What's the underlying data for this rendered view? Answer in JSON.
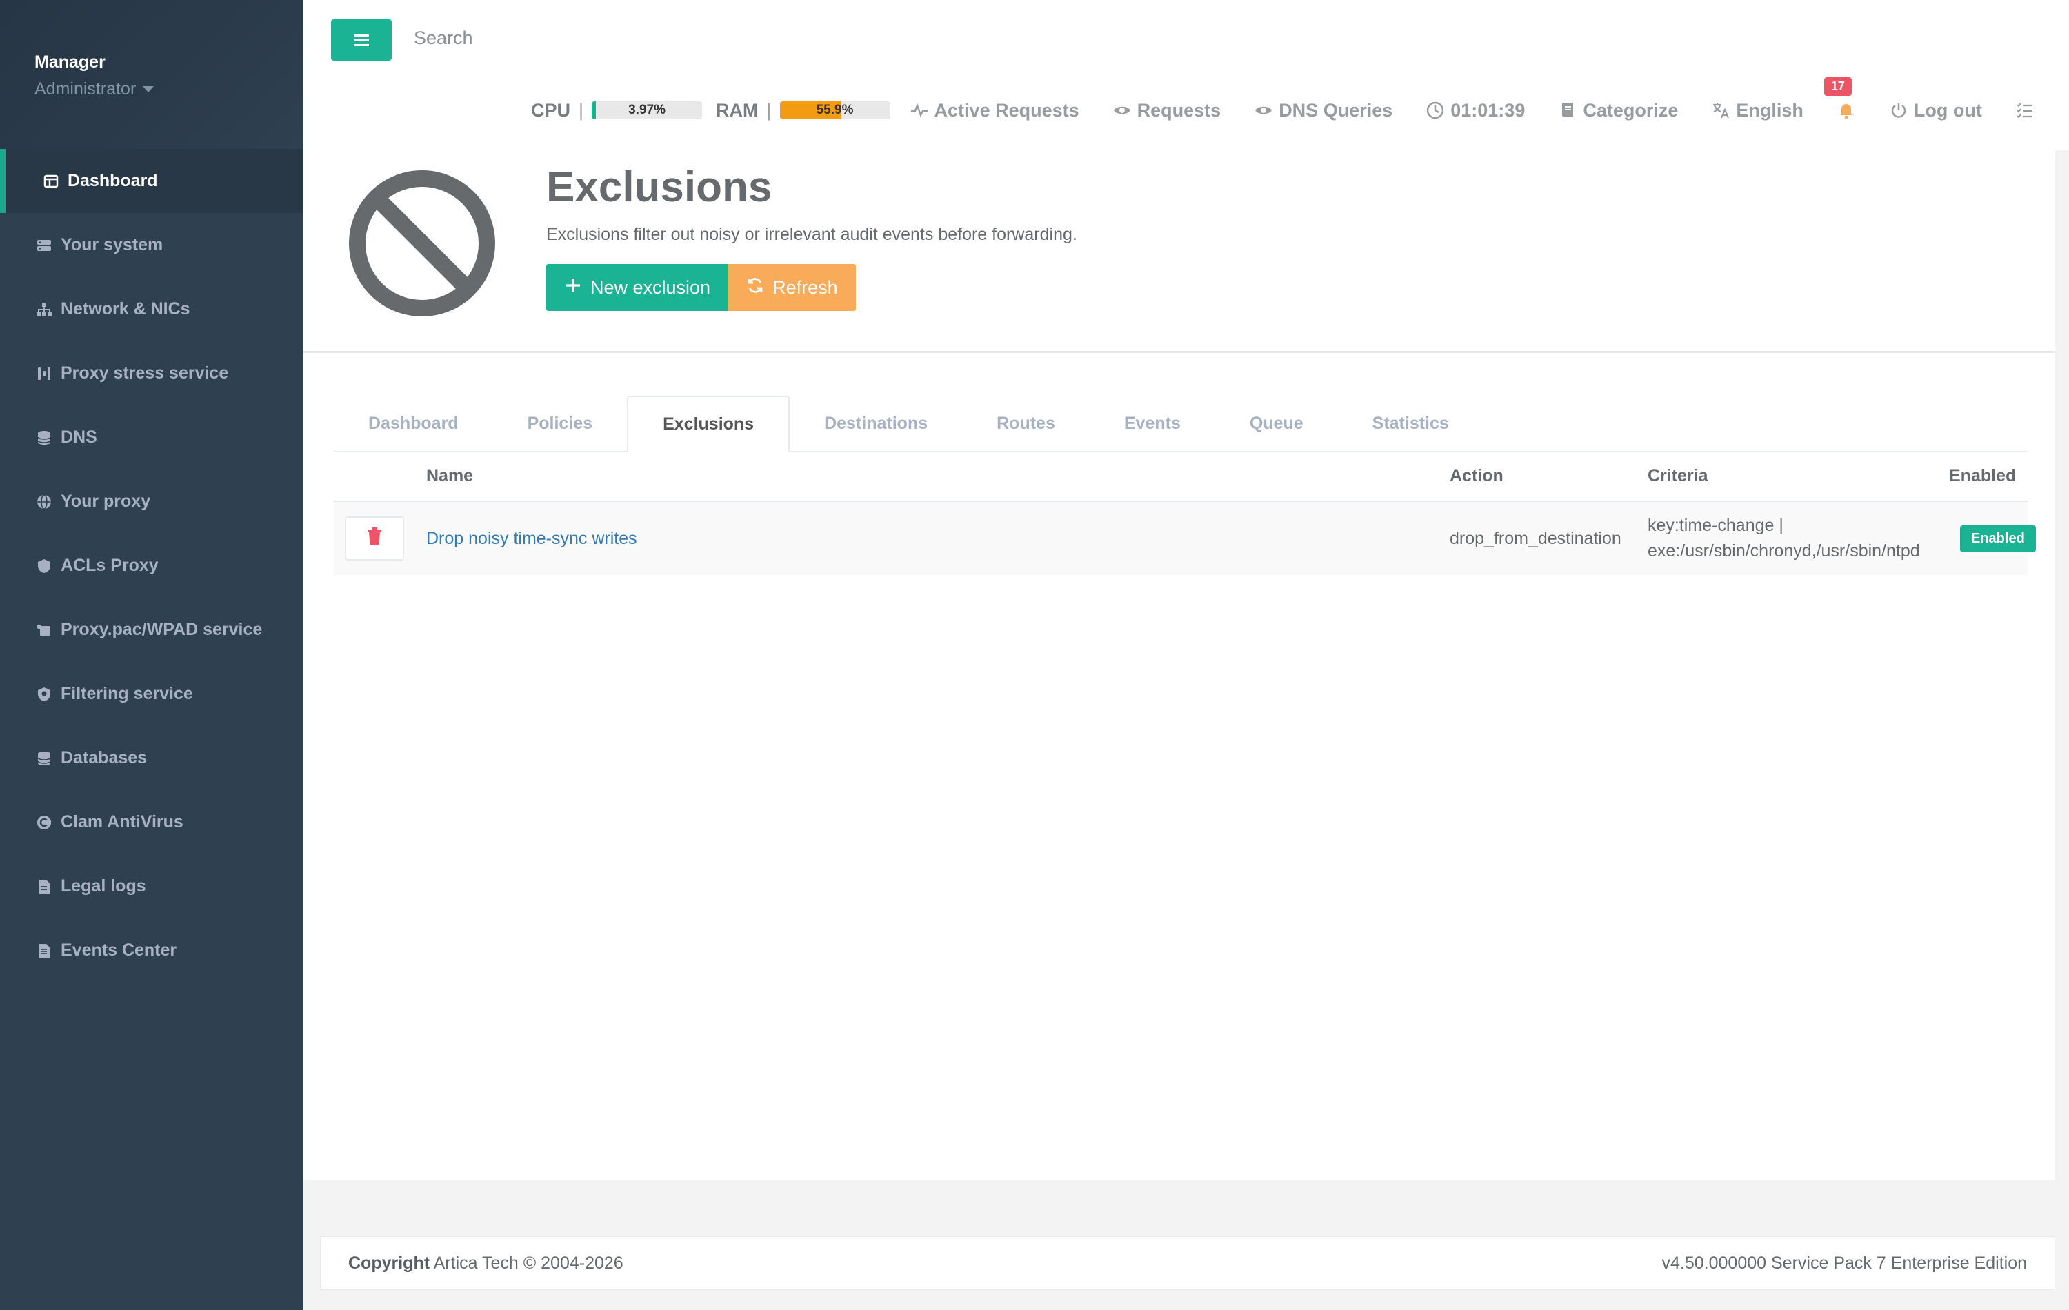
{
  "sidebar": {
    "user_name": "Manager",
    "user_role": "Administrator",
    "items": [
      {
        "label": "Dashboard",
        "icon": "dashboard-icon"
      },
      {
        "label": "Your system",
        "icon": "server-icon"
      },
      {
        "label": "Network & NICs",
        "icon": "network-icon"
      },
      {
        "label": "Proxy stress service",
        "icon": "stress-icon"
      },
      {
        "label": "DNS",
        "icon": "database-icon"
      },
      {
        "label": "Your proxy",
        "icon": "globe-icon"
      },
      {
        "label": "ACLs Proxy",
        "icon": "shield-icon"
      },
      {
        "label": "Proxy.pac/WPAD service",
        "icon": "scroll-icon"
      },
      {
        "label": "Filtering service",
        "icon": "shield-virus-icon"
      },
      {
        "label": "Databases",
        "icon": "database-icon"
      },
      {
        "label": "Clam AntiVirus",
        "icon": "clam-icon"
      },
      {
        "label": "Legal logs",
        "icon": "file-icon"
      },
      {
        "label": "Events Center",
        "icon": "file-lines-icon"
      }
    ]
  },
  "topbar": {
    "search_placeholder": "Search",
    "cpu_label": "CPU",
    "cpu_value": "3.97%",
    "cpu_fraction": 0.0397,
    "ram_label": "RAM",
    "ram_value": "55.9%",
    "ram_fraction": 0.559,
    "active_requests": "Active Requests",
    "requests": "Requests",
    "dns_queries": "DNS Queries",
    "time": "01:01:39",
    "categorize": "Categorize",
    "language": "English",
    "notifications": "17",
    "logout": "Log out"
  },
  "header": {
    "title": "Exclusions",
    "subtitle": "Exclusions filter out noisy or irrelevant audit events before forwarding.",
    "new_button": "New exclusion",
    "refresh_button": "Refresh"
  },
  "tabs": [
    {
      "label": "Dashboard"
    },
    {
      "label": "Policies"
    },
    {
      "label": "Exclusions"
    },
    {
      "label": "Destinations"
    },
    {
      "label": "Routes"
    },
    {
      "label": "Events"
    },
    {
      "label": "Queue"
    },
    {
      "label": "Statistics"
    }
  ],
  "table": {
    "headers": {
      "name": "Name",
      "action": "Action",
      "criteria": "Criteria",
      "enabled": "Enabled"
    },
    "rows": [
      {
        "name": "Drop noisy time-sync writes",
        "action": "drop_from_destination",
        "criteria_line1": "key:time-change |",
        "criteria_line2": "exe:/usr/sbin/chronyd,/usr/sbin/ntpd",
        "enabled": "Enabled"
      }
    ]
  },
  "footer": {
    "copyright_bold": "Copyright",
    "copyright_text": "Artica Tech © 2004-2026",
    "version": "v4.50.000000 Service Pack 7 Enterprise Edition"
  },
  "colors": {
    "accent": "#1ab394",
    "sidebar": "#2f4050",
    "orange": "#f8ac59",
    "danger": "#ed5565",
    "cpu_fill": "#1ab394",
    "ram_fill": "#f39c12"
  }
}
